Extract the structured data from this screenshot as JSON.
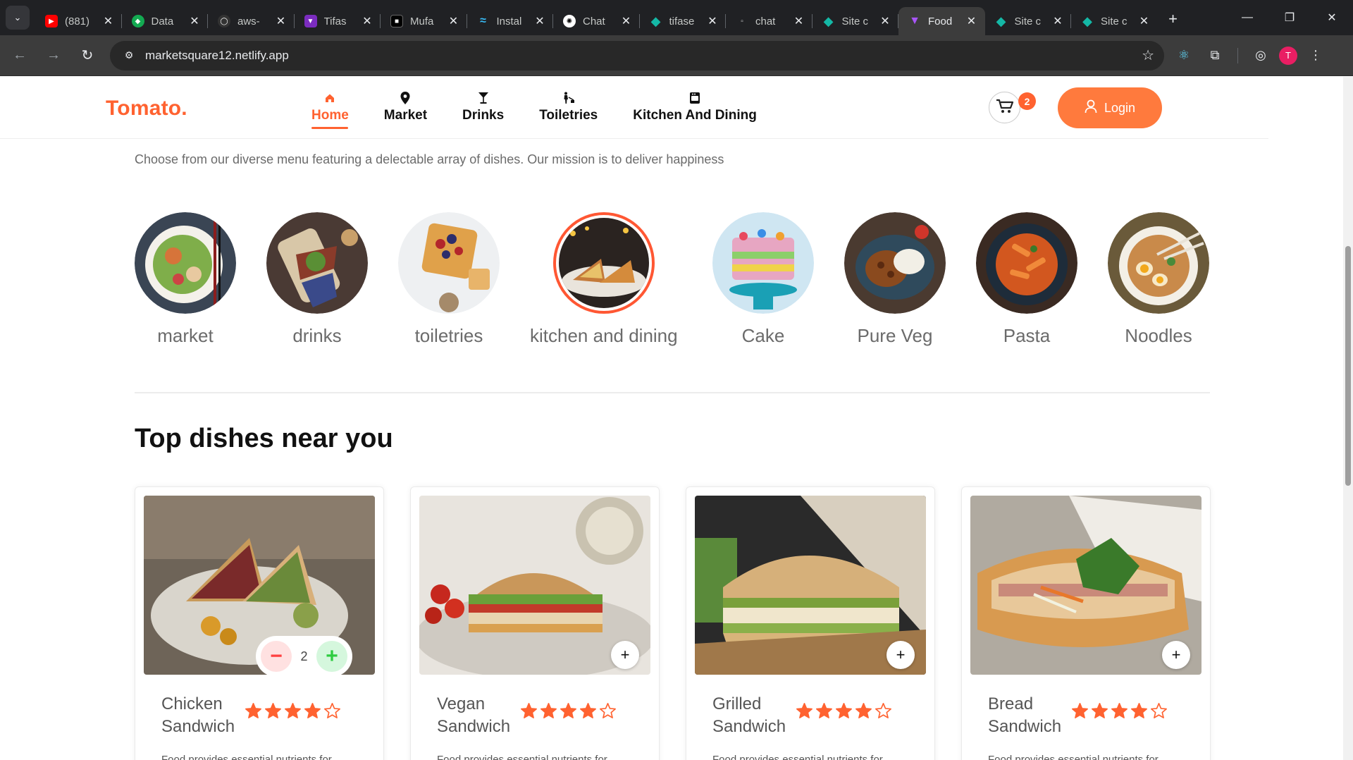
{
  "browser": {
    "tabs": [
      {
        "title": "(881)",
        "fav_color": "#ff0000",
        "fav_glyph": "▶"
      },
      {
        "title": "Data",
        "fav_color": "#13aa52",
        "fav_glyph": "◆"
      },
      {
        "title": "aws-",
        "fav_color": "#333333",
        "fav_glyph": "◯"
      },
      {
        "title": "Tifas",
        "fav_color": "#7b2cbf",
        "fav_glyph": "▼"
      },
      {
        "title": "Mufa",
        "fav_color": "#000000",
        "fav_glyph": "■"
      },
      {
        "title": "Instal",
        "fav_color": "#38bdf8",
        "fav_glyph": "≈"
      },
      {
        "title": "Chat",
        "fav_color": "#ffffff",
        "fav_glyph": "✺"
      },
      {
        "title": "tifase",
        "fav_color": "#14b8a6",
        "fav_glyph": "◆"
      },
      {
        "title": "chat",
        "fav_color": "#444444",
        "fav_glyph": "▫"
      },
      {
        "title": "Site c",
        "fav_color": "#14b8a6",
        "fav_glyph": "◆"
      },
      {
        "title": "Food",
        "fav_color": "#7b2cbf",
        "fav_glyph": "▼",
        "active": true
      },
      {
        "title": "Site c",
        "fav_color": "#14b8a6",
        "fav_glyph": "◆"
      },
      {
        "title": "Site c",
        "fav_color": "#14b8a6",
        "fav_glyph": "◆"
      }
    ],
    "url": "marketsquare12.netlify.app",
    "profile_initial": "T"
  },
  "site": {
    "logo": "Tomato.",
    "accent": "#ff6230",
    "nav": [
      {
        "label": "Home",
        "icon": "home-icon",
        "active": true
      },
      {
        "label": "Market",
        "icon": "location-pin-icon"
      },
      {
        "label": "Drinks",
        "icon": "cocktail-glass-icon"
      },
      {
        "label": "Toiletries",
        "icon": "person-cleaning-icon"
      },
      {
        "label": "Kitchen And Dining",
        "icon": "kitchen-icon"
      }
    ],
    "cart_count": "2",
    "login_label": "Login"
  },
  "intro_text": "Choose from our diverse menu featuring a delectable array of dishes. Our mission is to deliver happiness",
  "categories": [
    {
      "label": "market"
    },
    {
      "label": "drinks"
    },
    {
      "label": "toiletries"
    },
    {
      "label": "kitchen and dining",
      "active": true
    },
    {
      "label": "Cake"
    },
    {
      "label": "Pure Veg"
    },
    {
      "label": "Pasta"
    },
    {
      "label": "Noodles"
    }
  ],
  "section_title": "Top dishes near you",
  "dishes": [
    {
      "name": "Chicken Sandwich",
      "rating": 4,
      "desc": "Food provides essential nutrients for",
      "qty": "2"
    },
    {
      "name": "Vegan Sandwich",
      "rating": 4,
      "desc": "Food provides essential nutrients for"
    },
    {
      "name": "Grilled Sandwich",
      "rating": 4,
      "desc": "Food provides essential nutrients for"
    },
    {
      "name": "Bread Sandwich",
      "rating": 4,
      "desc": "Food provides essential nutrients for"
    }
  ]
}
